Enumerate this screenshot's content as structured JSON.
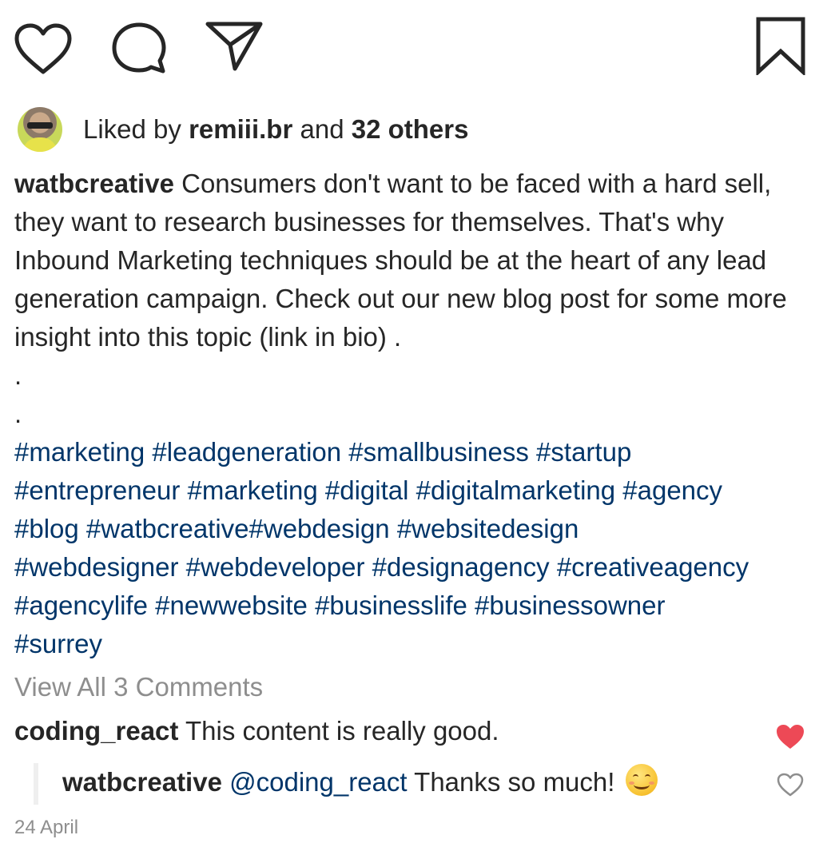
{
  "actions": {
    "like_icon": "heart-icon",
    "comment_icon": "comment-bubble-icon",
    "share_icon": "paper-plane-icon",
    "save_icon": "bookmark-icon"
  },
  "likes": {
    "prefix": "Liked by",
    "user": "remiii.br",
    "conjunction": "and",
    "others": "32 others"
  },
  "caption": {
    "username": "watbcreative",
    "text": "Consumers don't want to be faced with a hard sell, they want to research businesses for themselves. That's why Inbound Marketing techniques should be at the heart of any lead generation campaign. Check out our new blog post for some more insight into this topic (link in bio) .",
    "dots": [
      ".",
      "."
    ],
    "hashtags": [
      "#marketing #leadgeneration  #smallbusiness #startup",
      "#entrepreneur #marketing #digital #digitalmarketing #agency",
      "#blog #watbcreative#webdesign #websitedesign",
      "#webdesigner #webdeveloper #designagency #creativeagency",
      "#agencylife #newwebsite  #businesslife #businessowner",
      "#surrey"
    ]
  },
  "comments": {
    "view_all": "View All 3 Comments",
    "items": [
      {
        "username": "coding_react",
        "text": "This content is really good.",
        "liked": true
      }
    ],
    "reply": {
      "username": "watbcreative",
      "mention": "@coding_react",
      "text": "Thanks so much!",
      "emoji": "smiling-face-emoji",
      "liked": false
    }
  },
  "date": "24 April",
  "colors": {
    "text": "#262626",
    "hashtag": "#003569",
    "muted": "#8e8e8e",
    "like_red": "#ed4956"
  }
}
